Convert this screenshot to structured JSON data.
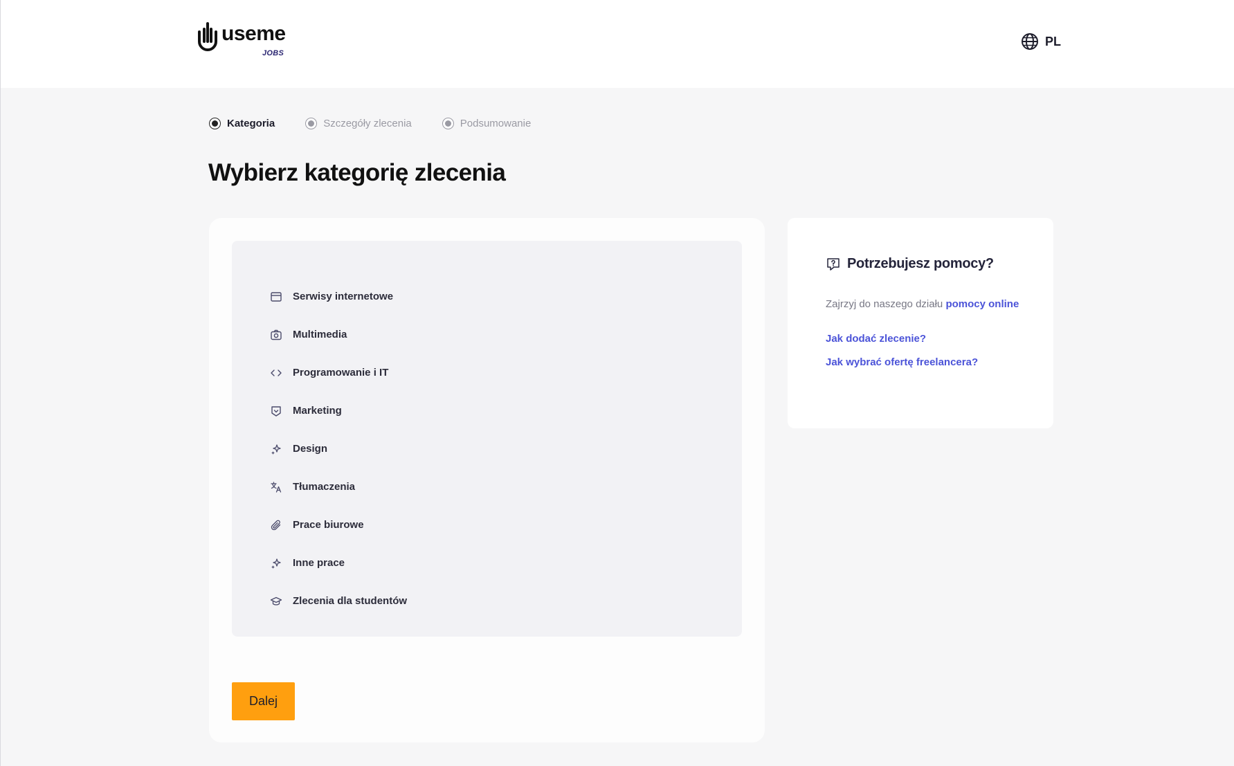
{
  "header": {
    "logo_text": "useme",
    "logo_sub": "JOBS",
    "language": "PL"
  },
  "stepper": {
    "steps": [
      {
        "label": "Kategoria",
        "active": true
      },
      {
        "label": "Szczegóły zlecenia",
        "active": false
      },
      {
        "label": "Podsumowanie",
        "active": false
      }
    ]
  },
  "main": {
    "title": "Wybierz kategorię zlecenia",
    "categories": [
      {
        "label": "Serwisy internetowe",
        "icon": "browser-window-icon"
      },
      {
        "label": "Multimedia",
        "icon": "camera-icon"
      },
      {
        "label": "Programowanie i IT",
        "icon": "code-icon"
      },
      {
        "label": "Marketing",
        "icon": "badge-icon"
      },
      {
        "label": "Design",
        "icon": "sparkles-icon"
      },
      {
        "label": "Tłumaczenia",
        "icon": "translate-icon"
      },
      {
        "label": "Prace biurowe",
        "icon": "paperclip-icon"
      },
      {
        "label": "Inne prace",
        "icon": "sparkles-icon"
      },
      {
        "label": "Zlecenia dla studentów",
        "icon": "graduation-cap-icon"
      }
    ],
    "next_button": "Dalej"
  },
  "help": {
    "title": "Potrzebujesz pomocy?",
    "text_prefix": "Zajrzyj do naszego działu ",
    "text_link": "pomocy online",
    "links": [
      "Jak dodać zlecenie?",
      "Jak wybrać ofertę freelancera?"
    ]
  },
  "colors": {
    "accent": "#ff9f0f",
    "link": "#4b53d8",
    "background": "#f6f6f7"
  }
}
